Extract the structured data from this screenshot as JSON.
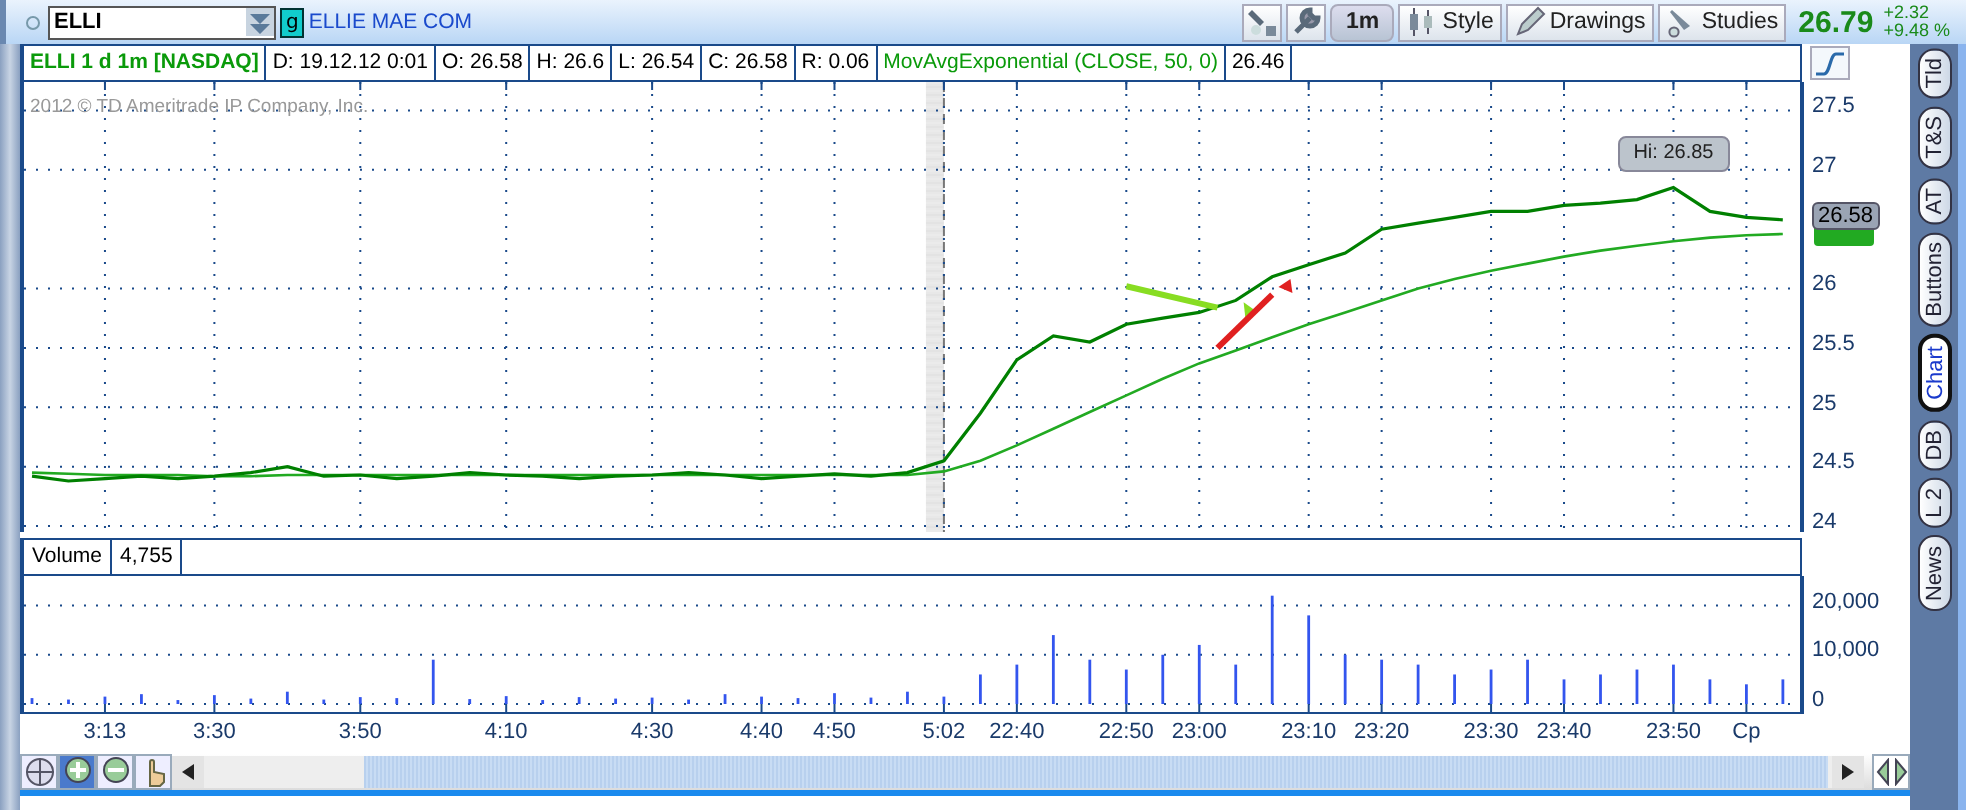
{
  "toolbar": {
    "symbol": "ELLI",
    "group_badge": "g",
    "company_link": "ELLIE MAE COM",
    "interval_button": "1m",
    "buttons": [
      "Style",
      "Drawings",
      "Studies"
    ],
    "last_price": "26.79",
    "change": "+2.32",
    "change_percent": "+9.48 %"
  },
  "info_row": {
    "fields": [
      "D: 19.12.12 0:01",
      "O: 26.58",
      "H: 26.6",
      "L: 26.54",
      "C: 26.58",
      "R: 0.06"
    ],
    "study_value": "26.46"
  },
  "price_chart": {
    "copyright": "2012 © TD Ameritrade IP Company, Inc.",
    "last_price_label": "26.58",
    "chart_data": {
      "type": "line",
      "ylim": [
        23.95,
        27.74
      ],
      "series": [
        {
          "name": "ELLI 1 d 1m [NASDAQ]",
          "color": "#008000",
          "values": [
            24.42,
            24.38,
            24.4,
            24.42,
            24.4,
            24.42,
            24.45,
            24.5,
            24.42,
            24.43,
            24.4,
            24.42,
            24.45,
            24.43,
            24.42,
            24.4,
            24.42,
            24.43,
            24.45,
            24.43,
            24.4,
            24.42,
            24.44,
            24.42,
            24.45,
            24.55,
            24.95,
            25.4,
            25.6,
            25.55,
            25.7,
            25.75,
            25.8,
            25.9,
            26.1,
            26.2,
            26.3,
            26.5,
            26.55,
            26.6,
            26.65,
            26.65,
            26.7,
            26.72,
            26.75,
            26.85,
            26.65,
            26.6,
            26.58
          ]
        },
        {
          "name": "MovAvgExponential (CLOSE, 50, 0)",
          "color": "#22aa22",
          "values": [
            24.45,
            24.44,
            24.43,
            24.43,
            24.43,
            24.42,
            24.42,
            24.43,
            24.43,
            24.43,
            24.43,
            24.43,
            24.43,
            24.43,
            24.43,
            24.43,
            24.43,
            24.43,
            24.43,
            24.43,
            24.43,
            24.43,
            24.43,
            24.43,
            24.43,
            24.46,
            24.55,
            24.68,
            24.82,
            24.96,
            25.1,
            25.24,
            25.37,
            25.48,
            25.59,
            25.7,
            25.8,
            25.9,
            26.0,
            26.08,
            26.15,
            26.21,
            26.27,
            26.32,
            26.36,
            26.4,
            26.43,
            26.45,
            26.46
          ]
        }
      ],
      "yticks": [
        {
          "value": 24,
          "label": "24"
        },
        {
          "value": 24.5,
          "label": "24.5"
        },
        {
          "value": 25,
          "label": "25"
        },
        {
          "value": 25.5,
          "label": "25.5"
        },
        {
          "value": 26,
          "label": "26"
        },
        {
          "value": 27,
          "label": "27"
        },
        {
          "value": 27.5,
          "label": "27.5"
        }
      ],
      "grid": true,
      "annotations": [
        {
          "text": "Hi: 26.85"
        }
      ]
    }
  },
  "volume_chart": {
    "value": "4,755",
    "chart_data": {
      "type": "bar",
      "ylim": [
        0,
        26000
      ],
      "categories": [
        null,
        null,
        "3:13",
        null,
        null,
        "3:30",
        null,
        null,
        null,
        "3:50",
        null,
        null,
        null,
        "4:10",
        null,
        null,
        null,
        "4:30",
        null,
        null,
        "4:40",
        null,
        "4:50",
        null,
        null,
        "5:02",
        null,
        "22:40",
        null,
        null,
        "22:50",
        null,
        "23:00",
        null,
        null,
        "23:10",
        null,
        "23:20",
        null,
        null,
        "23:30",
        null,
        "23:40",
        null,
        null,
        "23:50",
        null,
        "Cp",
        null
      ],
      "series": [
        {
          "name": "Volume",
          "color": "#3355ee",
          "values": [
            1200,
            900,
            1500,
            2000,
            800,
            1800,
            1100,
            2500,
            900,
            1400,
            1200,
            9000,
            1000,
            1600,
            800,
            1400,
            1100,
            1300,
            900,
            2000,
            1500,
            1200,
            2200,
            1300,
            2500,
            1500,
            6000,
            8000,
            14000,
            9000,
            7000,
            10000,
            12000,
            8000,
            22000,
            18000,
            10000,
            9000,
            8000,
            6000,
            7000,
            9000,
            5000,
            6000,
            7000,
            8000,
            5000,
            4000,
            5000
          ]
        }
      ],
      "grid": true,
      "yticks": [
        {
          "value": 0,
          "label": "0"
        },
        {
          "value": 10000,
          "label": "10,000"
        },
        {
          "value": 20000,
          "label": "20,000"
        }
      ]
    }
  },
  "side_tabs": [
    {
      "label": "Tld",
      "selected": false
    },
    {
      "label": "T&S",
      "selected": false
    },
    {
      "label": "AT",
      "selected": false
    },
    {
      "label": "Buttons",
      "selected": false
    },
    {
      "label": "Chart",
      "selected": true
    },
    {
      "label": "DB",
      "selected": false
    },
    {
      "label": "L 2",
      "selected": false
    },
    {
      "label": "News",
      "selected": false
    }
  ]
}
